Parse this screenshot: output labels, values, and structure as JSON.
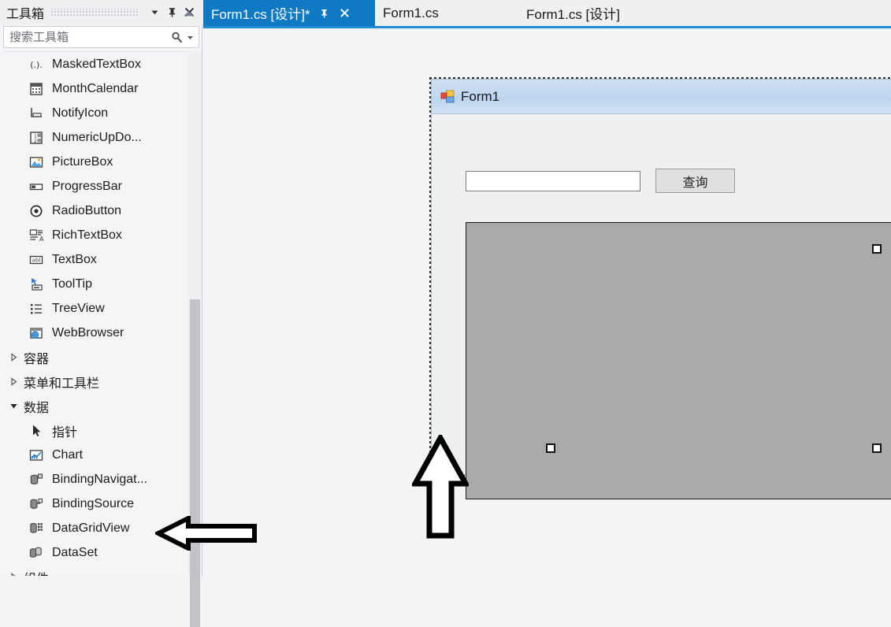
{
  "toolbox": {
    "title": "工具箱",
    "header_icons": [
      {
        "name": "chevron-down-icon",
        "glyph": "▼"
      },
      {
        "name": "pin-icon",
        "glyph": "⊹"
      },
      {
        "name": "close-icon",
        "glyph": "✕"
      }
    ],
    "search": {
      "placeholder": "搜索工具箱",
      "value": "",
      "icon": "search-icon",
      "caret": "▾"
    },
    "items": [
      {
        "label": "MaskedTextBox",
        "icon": "masked-textbox-icon",
        "kind": "item"
      },
      {
        "label": "MonthCalendar",
        "icon": "month-calendar-icon",
        "kind": "item"
      },
      {
        "label": "NotifyIcon",
        "icon": "notify-icon",
        "kind": "item"
      },
      {
        "label": "NumericUpDo...",
        "icon": "numeric-updown-icon",
        "kind": "item"
      },
      {
        "label": "PictureBox",
        "icon": "picture-box-icon",
        "kind": "item"
      },
      {
        "label": "ProgressBar",
        "icon": "progress-bar-icon",
        "kind": "item"
      },
      {
        "label": "RadioButton",
        "icon": "radio-button-icon",
        "kind": "item"
      },
      {
        "label": "RichTextBox",
        "icon": "rich-textbox-icon",
        "kind": "item"
      },
      {
        "label": "TextBox",
        "icon": "textbox-icon",
        "kind": "item"
      },
      {
        "label": "ToolTip",
        "icon": "tooltip-icon",
        "kind": "item"
      },
      {
        "label": "TreeView",
        "icon": "treeview-icon",
        "kind": "item"
      },
      {
        "label": "WebBrowser",
        "icon": "webbrowser-icon",
        "kind": "item"
      },
      {
        "label": "容器",
        "icon": "triangle-right-icon",
        "kind": "group",
        "expanded": false
      },
      {
        "label": "菜单和工具栏",
        "icon": "triangle-right-icon",
        "kind": "group",
        "expanded": false
      },
      {
        "label": "数据",
        "icon": "triangle-down-icon",
        "kind": "group",
        "expanded": true
      },
      {
        "label": "指针",
        "icon": "pointer-icon",
        "kind": "item"
      },
      {
        "label": "Chart",
        "icon": "chart-icon",
        "kind": "item"
      },
      {
        "label": "BindingNavigat...",
        "icon": "binding-navigator-icon",
        "kind": "item"
      },
      {
        "label": "BindingSource",
        "icon": "binding-source-icon",
        "kind": "item"
      },
      {
        "label": "DataGridView",
        "icon": "datagridview-icon",
        "kind": "item"
      },
      {
        "label": "DataSet",
        "icon": "dataset-icon",
        "kind": "item"
      },
      {
        "label": "组件",
        "icon": "triangle-right-icon",
        "kind": "group",
        "expanded": false
      }
    ],
    "collapse_icon": "collapse-up-icon",
    "scrollbar": {
      "name": "toolbox-scrollbar"
    }
  },
  "tabs": [
    {
      "label": "Form1.cs [设计]*",
      "active": true,
      "pin": "⊹",
      "close": "✕"
    },
    {
      "label": "Form1.cs",
      "active": false
    },
    {
      "label": "Form1.cs [设计]",
      "active": false
    }
  ],
  "designer": {
    "form": {
      "title": "Form1",
      "icon": "form-icon",
      "window_buttons": [
        {
          "name": "minimize-button",
          "glyph": "—"
        },
        {
          "name": "maximize-button",
          "glyph": "❐"
        },
        {
          "name": "close-button",
          "glyph": "✕"
        }
      ],
      "controls": {
        "textbox": {
          "name": "search-textbox",
          "value": ""
        },
        "button": {
          "name": "query-button",
          "label": "查询"
        },
        "datagrid": {
          "name": "datagridview-placeholder",
          "label": ""
        }
      }
    },
    "annotations": [
      {
        "name": "arrow-up-annotation",
        "direction": "up"
      },
      {
        "name": "arrow-left-annotation",
        "direction": "left"
      }
    ]
  },
  "colors": {
    "tab_active_bg": "#0e7ac4",
    "tab_underline": "#1f8bd4",
    "form_titlebar": "#c2d8ef",
    "close_button": "#c6453c",
    "grid_placeholder": "#a9a9a9",
    "panel_bg": "#f5f5f7"
  }
}
